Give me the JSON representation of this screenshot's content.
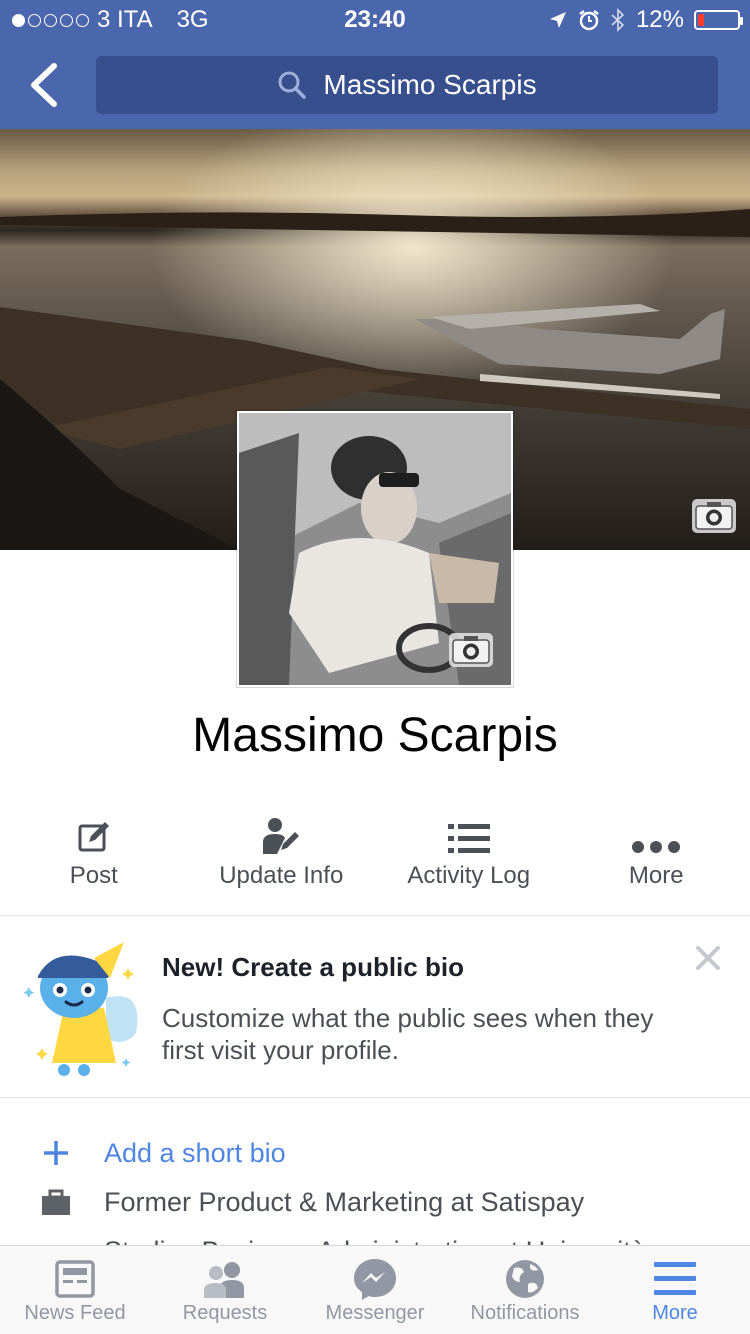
{
  "status_bar": {
    "carrier": "3 ITA",
    "network": "3G",
    "time": "23:40",
    "battery": "12%"
  },
  "nav": {
    "search_text": "Massimo Scarpis"
  },
  "profile": {
    "name": "Massimo Scarpis"
  },
  "actions": [
    {
      "label": "Post",
      "icon": "edit-icon"
    },
    {
      "label": "Update Info",
      "icon": "person-edit-icon"
    },
    {
      "label": "Activity Log",
      "icon": "list-icon"
    },
    {
      "label": "More",
      "icon": "ellipsis-icon"
    }
  ],
  "bio_card": {
    "title": "New! Create a public bio",
    "description": "Customize what the public sees when they first visit your profile."
  },
  "info": {
    "add_bio": "Add a short bio",
    "work": "Former Product & Marketing at Satispay",
    "education": "Studies Business Administration at Università"
  },
  "tabs": [
    {
      "label": "News Feed",
      "icon": "news-feed-icon"
    },
    {
      "label": "Requests",
      "icon": "friends-icon"
    },
    {
      "label": "Messenger",
      "icon": "messenger-icon"
    },
    {
      "label": "Notifications",
      "icon": "globe-icon"
    },
    {
      "label": "More",
      "icon": "menu-icon"
    }
  ],
  "colors": {
    "brand": "#4a67ad",
    "link": "#4e86e4",
    "tab_inactive": "#9197a3"
  }
}
